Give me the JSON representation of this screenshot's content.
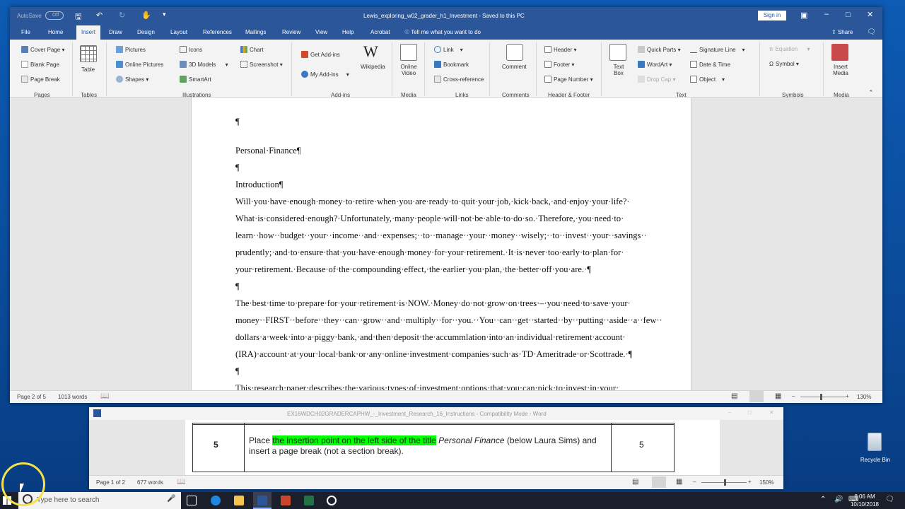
{
  "window": {
    "title": "Lewis_exploring_w02_grader_h1_Investment  -  Saved to this PC",
    "autosave_label": "AutoSave",
    "autosave_state": "Off",
    "signin_label": "Sign in"
  },
  "tabs": [
    "File",
    "Home",
    "Insert",
    "Draw",
    "Design",
    "Layout",
    "References",
    "Mailings",
    "Review",
    "View",
    "Help",
    "Acrobat"
  ],
  "active_tab": "Insert",
  "tell_me": "Tell me what you want to do",
  "share_label": "Share",
  "ribbon": {
    "pages": {
      "cover_page": "Cover Page",
      "blank_page": "Blank Page",
      "page_break": "Page Break",
      "group": "Pages"
    },
    "tables": {
      "table": "Table",
      "group": "Tables"
    },
    "illustrations": {
      "pictures": "Pictures",
      "online_pictures": "Online Pictures",
      "shapes": "Shapes",
      "icons": "Icons",
      "models_3d": "3D Models",
      "smartart": "SmartArt",
      "chart": "Chart",
      "screenshot": "Screenshot",
      "group": "Illustrations"
    },
    "addins": {
      "get_addins": "Get Add-ins",
      "my_addins": "My Add-ins",
      "wikipedia": "Wikipedia",
      "group": "Add-ins"
    },
    "media": {
      "online_video_1": "Online",
      "online_video_2": "Video",
      "group": "Media"
    },
    "links": {
      "link": "Link",
      "bookmark": "Bookmark",
      "cross_reference": "Cross-reference",
      "group": "Links"
    },
    "comments": {
      "comment": "Comment",
      "group": "Comments"
    },
    "header_footer": {
      "header": "Header",
      "footer": "Footer",
      "page_number": "Page Number",
      "group": "Header & Footer"
    },
    "text": {
      "text_box_1": "Text",
      "text_box_2": "Box",
      "quick_parts": "Quick Parts",
      "wordart": "WordArt",
      "drop_cap": "Drop Cap",
      "signature_line": "Signature Line",
      "date_time": "Date & Time",
      "object": "Object",
      "group": "Text"
    },
    "symbols": {
      "equation": "Equation",
      "symbol": "Symbol",
      "group": "Symbols"
    },
    "media2": {
      "insert_media_1": "Insert",
      "insert_media_2": "Media",
      "group": "Media"
    }
  },
  "document": {
    "pilcrow": "¶",
    "title": "Personal·Finance¶",
    "heading": "Introduction¶",
    "para1": [
      "Will·you·have·enough·money·to·retire·when·you·are·ready·to·quit·your·job,·kick·back,·and·enjoy·your·life?·",
      "What·is·considered·enough?·Unfortunately,·many·people·will·not·be·able·to·do·so.·Therefore,·you·need·to·",
      "learn··how··budget··your··income··and··expenses;··to··manage··your··money··wisely;··to··invest··your··savings··",
      "prudently;·and·to·ensure·that·you·have·enough·money·for·your·retirement.·It·is·never·too·early·to·plan·for·",
      "your·retirement.·Because·of·the·compounding·effect,·the·earlier·you·plan,·the·better·off·you·are.·¶"
    ],
    "para2": [
      "The·best·time·to·prepare·for·your·retirement·is·NOW.·Money·do·not·grow·on·trees·–·you·need·to·save·your·",
      "money··FIRST··before··they··can··grow··and··multiply··for··you.··You··can··get··started··by··putting··aside··a··few··",
      "dollars·a·week·into·a·piggy·bank,·and·then·deposit·the·accummlation·into·an·individual·retirement·account·",
      "(IRA)·account·at·your·local·bank·or·any·online·investment·companies·such·as·TD·Ameritrade·or·Scottrade.·¶"
    ],
    "last_line": "This·research·paper·describes·the·various·types·of·investment·options·that·you·can·pick·to·invest·in·your·"
  },
  "status": {
    "page": "Page 2 of 5",
    "words": "1013 words",
    "zoom": "130%"
  },
  "window2": {
    "title": "EX16WDCH02GRADERCAPHW_-_Investment_Research_16_Instructions  -  Compatibility Mode  -  Word",
    "step": "5",
    "instruction_before": "Place ",
    "instruction_highlight": "the insertion point on the left side of the title",
    "instruction_italic": " Personal Finance",
    "instruction_after": " (below Laura Sims) and",
    "instruction_line2": "insert a page break (not a section break).",
    "points": "5",
    "status_page": "Page 1 of 2",
    "status_words": "677 words",
    "zoom": "150%"
  },
  "taskbar": {
    "search_placeholder": "Type here to search",
    "time": "8:06 AM",
    "date": "10/10/2018"
  },
  "desktop": {
    "recycle_bin": "Recycle Bin"
  }
}
